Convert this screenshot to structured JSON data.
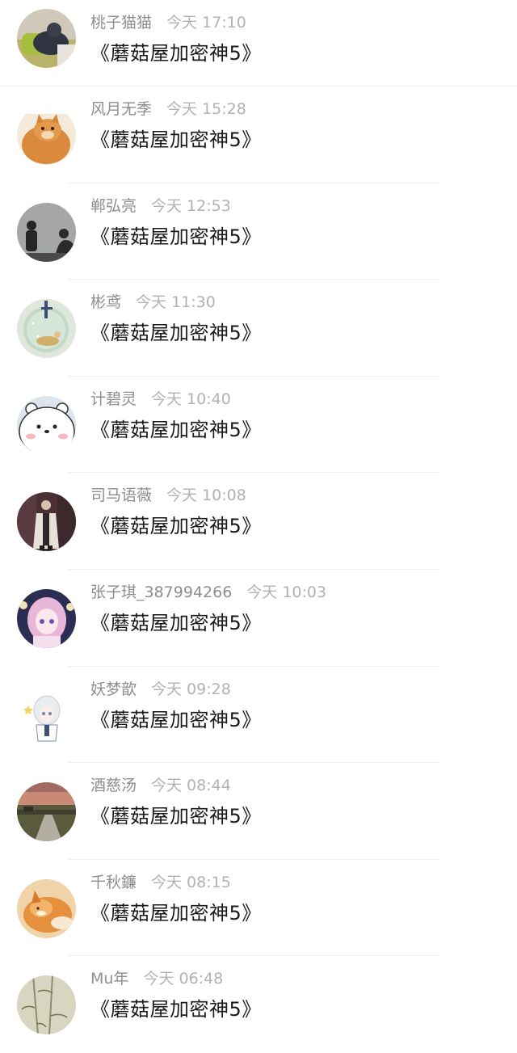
{
  "messages": [
    {
      "name": "桃子猫猫",
      "time": "今天 17:10",
      "text": "《蘑菇屋加密神5》",
      "avatar": "avatar-photo-person-sofa"
    },
    {
      "name": "风月无季",
      "time": "今天 15:28",
      "text": "《蘑菇屋加密神5》",
      "avatar": "avatar-photo-cat"
    },
    {
      "name": "郸弘亮",
      "time": "今天 12:53",
      "text": "《蘑菇屋加密神5》",
      "avatar": "avatar-photo-silhouettes"
    },
    {
      "name": "彬鸢",
      "time": "今天 11:30",
      "text": "《蘑菇屋加密神5》",
      "avatar": "avatar-photo-snow-globe"
    },
    {
      "name": "计碧灵",
      "time": "今天 10:40",
      "text": "《蘑菇屋加密神5》",
      "avatar": "avatar-cartoon-white-bear"
    },
    {
      "name": "司马语薇",
      "time": "今天 10:08",
      "text": "《蘑菇屋加密神5》",
      "avatar": "avatar-photo-man-coat"
    },
    {
      "name": "张子琪_387994266",
      "time": "今天 10:03",
      "text": "《蘑菇屋加密神5》",
      "avatar": "avatar-anime-girl-pink"
    },
    {
      "name": "妖梦歆",
      "time": "今天 09:28",
      "text": "《蘑菇屋加密神5》",
      "avatar": "avatar-anime-girl-white-hair"
    },
    {
      "name": "酒慈汤",
      "time": "今天 08:44",
      "text": "《蘑菇屋加密神5》",
      "avatar": "avatar-photo-sunset-road"
    },
    {
      "name": "千秋鐮",
      "time": "今天 08:15",
      "text": "《蘑菇屋加密神5》",
      "avatar": "avatar-photo-fox"
    },
    {
      "name": "Mu年",
      "time": "今天 06:48",
      "text": "《蘑菇屋加密神5》",
      "avatar": "avatar-photo-bamboo"
    }
  ],
  "colors": {
    "name": "#8e8e8e",
    "time": "#b2b2b2",
    "message": "#1a1a1a",
    "divider": "#f0f0f0"
  }
}
